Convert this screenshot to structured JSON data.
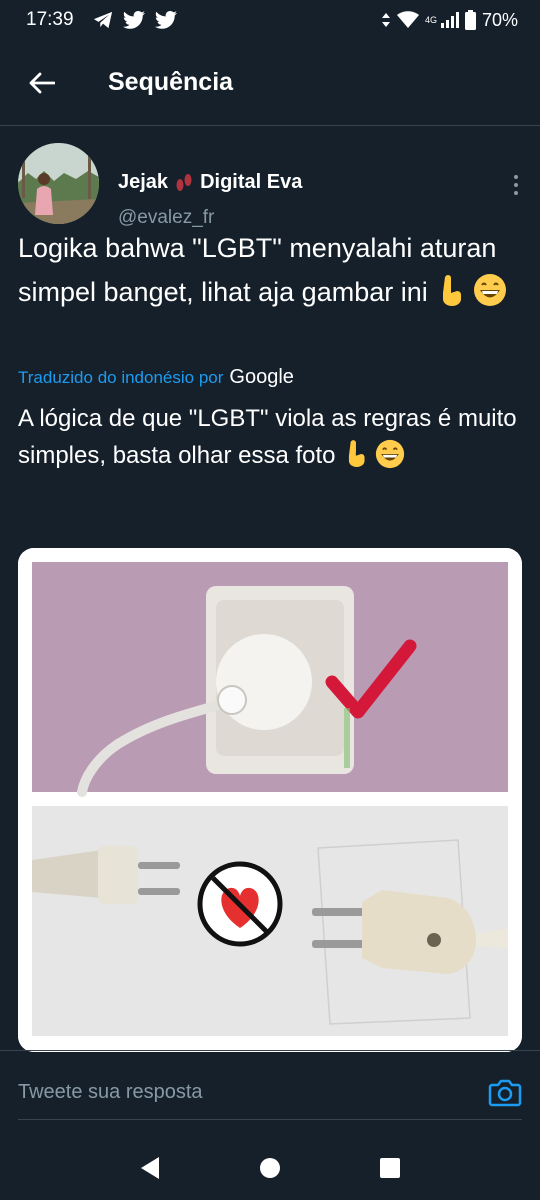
{
  "status_bar": {
    "time": "17:39",
    "battery": "70%",
    "network": "4G",
    "icons_left": [
      "telegram-icon",
      "twitter-icon",
      "twitter-icon"
    ],
    "icons_right": [
      "data-arrows-icon",
      "wifi-icon",
      "signal-icon",
      "battery-icon"
    ]
  },
  "header": {
    "title": "Sequência"
  },
  "tweet": {
    "author_name_first": "Jejak",
    "author_name_last": "Digital Eva",
    "author_handle": "@evalez_fr",
    "text": "Logika bahwa \"LGBT\" menyalahi aturan simpel banget, lihat aja gambar ini",
    "translated_label": "Traduzido do indonésio por",
    "translator": "Google",
    "translated_text": "A lógica de que \"LGBT\" viola as regras é muito simples, basta olhar essa foto"
  },
  "reply": {
    "placeholder": "Tweete sua resposta"
  },
  "colors": {
    "background": "#15202b",
    "accent": "#1d9bf0",
    "secondary_text": "#8899a6",
    "divider": "#38444d"
  }
}
